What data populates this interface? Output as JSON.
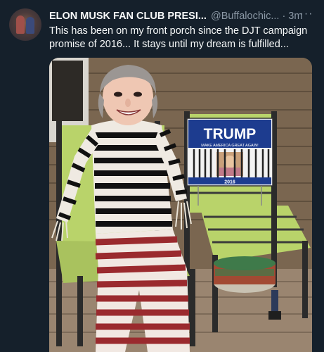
{
  "tweet": {
    "author_name": "ELON MUSK FAN CLUB PRESI...",
    "author_handle": "@Buffalochic...",
    "separator": "·",
    "time": "3m",
    "more_label": "···",
    "text": "This has been on my front porch since the DJT campaign promise of 2016... It stays until my dream is fulfilled..."
  },
  "photo": {
    "sign_title": "TRUMP",
    "sign_subtitle": "MAKE AMERICA GREAT AGAIN!",
    "sign_year": "2016"
  },
  "colors": {
    "background": "#15202b",
    "primary_text": "#f7f9f9",
    "secondary_text": "#8b98a5",
    "sign_blue": "#1d3c8f",
    "chair_green": "#b9d36a"
  }
}
